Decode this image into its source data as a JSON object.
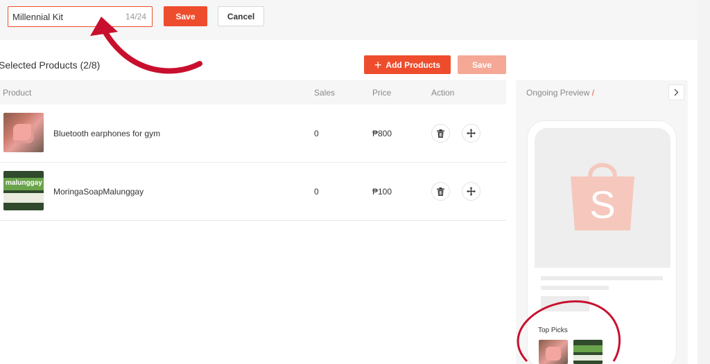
{
  "header": {
    "name_value": "Millennial Kit",
    "name_count": "14/24",
    "save_label": "Save",
    "cancel_label": "Cancel"
  },
  "section": {
    "title": "Selected Products (2/8)",
    "add_label": "Add Products",
    "save_label": "Save"
  },
  "table": {
    "columns": [
      "Product",
      "Sales",
      "Price",
      "Action"
    ],
    "rows": [
      {
        "name": "Bluetooth earphones for gym",
        "sales": "0",
        "price": "₱800",
        "thumb_text": ""
      },
      {
        "name": "MoringaSoapMalunggay",
        "sales": "0",
        "price": "₱100",
        "thumb_text": "malunggay"
      }
    ]
  },
  "preview": {
    "title": "Ongoing Preview",
    "slash": "/",
    "top_picks": "Top Picks"
  },
  "colors": {
    "accent": "#ee4d2d",
    "accent_disabled": "#f5a896",
    "annotation": "#c8102e"
  }
}
